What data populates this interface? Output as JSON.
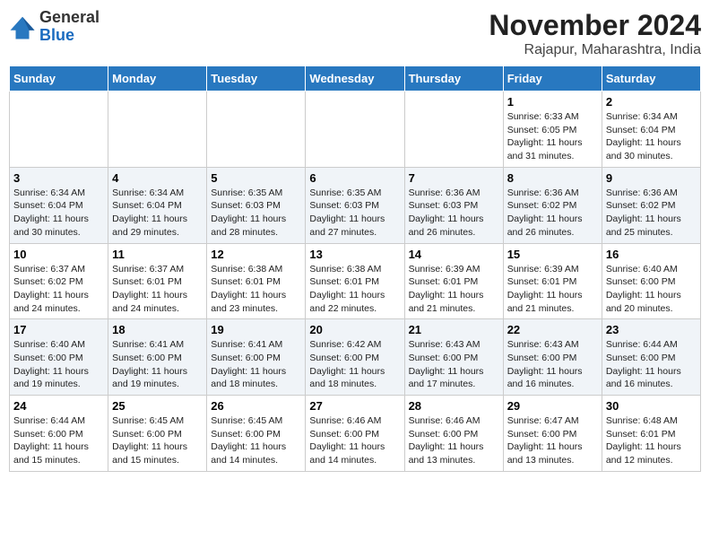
{
  "header": {
    "logo_line1": "General",
    "logo_line2": "Blue",
    "month": "November 2024",
    "location": "Rajapur, Maharashtra, India"
  },
  "days_of_week": [
    "Sunday",
    "Monday",
    "Tuesday",
    "Wednesday",
    "Thursday",
    "Friday",
    "Saturday"
  ],
  "weeks": [
    [
      {
        "day": "",
        "info": ""
      },
      {
        "day": "",
        "info": ""
      },
      {
        "day": "",
        "info": ""
      },
      {
        "day": "",
        "info": ""
      },
      {
        "day": "",
        "info": ""
      },
      {
        "day": "1",
        "info": "Sunrise: 6:33 AM\nSunset: 6:05 PM\nDaylight: 11 hours\nand 31 minutes."
      },
      {
        "day": "2",
        "info": "Sunrise: 6:34 AM\nSunset: 6:04 PM\nDaylight: 11 hours\nand 30 minutes."
      }
    ],
    [
      {
        "day": "3",
        "info": "Sunrise: 6:34 AM\nSunset: 6:04 PM\nDaylight: 11 hours\nand 30 minutes."
      },
      {
        "day": "4",
        "info": "Sunrise: 6:34 AM\nSunset: 6:04 PM\nDaylight: 11 hours\nand 29 minutes."
      },
      {
        "day": "5",
        "info": "Sunrise: 6:35 AM\nSunset: 6:03 PM\nDaylight: 11 hours\nand 28 minutes."
      },
      {
        "day": "6",
        "info": "Sunrise: 6:35 AM\nSunset: 6:03 PM\nDaylight: 11 hours\nand 27 minutes."
      },
      {
        "day": "7",
        "info": "Sunrise: 6:36 AM\nSunset: 6:03 PM\nDaylight: 11 hours\nand 26 minutes."
      },
      {
        "day": "8",
        "info": "Sunrise: 6:36 AM\nSunset: 6:02 PM\nDaylight: 11 hours\nand 26 minutes."
      },
      {
        "day": "9",
        "info": "Sunrise: 6:36 AM\nSunset: 6:02 PM\nDaylight: 11 hours\nand 25 minutes."
      }
    ],
    [
      {
        "day": "10",
        "info": "Sunrise: 6:37 AM\nSunset: 6:02 PM\nDaylight: 11 hours\nand 24 minutes."
      },
      {
        "day": "11",
        "info": "Sunrise: 6:37 AM\nSunset: 6:01 PM\nDaylight: 11 hours\nand 24 minutes."
      },
      {
        "day": "12",
        "info": "Sunrise: 6:38 AM\nSunset: 6:01 PM\nDaylight: 11 hours\nand 23 minutes."
      },
      {
        "day": "13",
        "info": "Sunrise: 6:38 AM\nSunset: 6:01 PM\nDaylight: 11 hours\nand 22 minutes."
      },
      {
        "day": "14",
        "info": "Sunrise: 6:39 AM\nSunset: 6:01 PM\nDaylight: 11 hours\nand 21 minutes."
      },
      {
        "day": "15",
        "info": "Sunrise: 6:39 AM\nSunset: 6:01 PM\nDaylight: 11 hours\nand 21 minutes."
      },
      {
        "day": "16",
        "info": "Sunrise: 6:40 AM\nSunset: 6:00 PM\nDaylight: 11 hours\nand 20 minutes."
      }
    ],
    [
      {
        "day": "17",
        "info": "Sunrise: 6:40 AM\nSunset: 6:00 PM\nDaylight: 11 hours\nand 19 minutes."
      },
      {
        "day": "18",
        "info": "Sunrise: 6:41 AM\nSunset: 6:00 PM\nDaylight: 11 hours\nand 19 minutes."
      },
      {
        "day": "19",
        "info": "Sunrise: 6:41 AM\nSunset: 6:00 PM\nDaylight: 11 hours\nand 18 minutes."
      },
      {
        "day": "20",
        "info": "Sunrise: 6:42 AM\nSunset: 6:00 PM\nDaylight: 11 hours\nand 18 minutes."
      },
      {
        "day": "21",
        "info": "Sunrise: 6:43 AM\nSunset: 6:00 PM\nDaylight: 11 hours\nand 17 minutes."
      },
      {
        "day": "22",
        "info": "Sunrise: 6:43 AM\nSunset: 6:00 PM\nDaylight: 11 hours\nand 16 minutes."
      },
      {
        "day": "23",
        "info": "Sunrise: 6:44 AM\nSunset: 6:00 PM\nDaylight: 11 hours\nand 16 minutes."
      }
    ],
    [
      {
        "day": "24",
        "info": "Sunrise: 6:44 AM\nSunset: 6:00 PM\nDaylight: 11 hours\nand 15 minutes."
      },
      {
        "day": "25",
        "info": "Sunrise: 6:45 AM\nSunset: 6:00 PM\nDaylight: 11 hours\nand 15 minutes."
      },
      {
        "day": "26",
        "info": "Sunrise: 6:45 AM\nSunset: 6:00 PM\nDaylight: 11 hours\nand 14 minutes."
      },
      {
        "day": "27",
        "info": "Sunrise: 6:46 AM\nSunset: 6:00 PM\nDaylight: 11 hours\nand 14 minutes."
      },
      {
        "day": "28",
        "info": "Sunrise: 6:46 AM\nSunset: 6:00 PM\nDaylight: 11 hours\nand 13 minutes."
      },
      {
        "day": "29",
        "info": "Sunrise: 6:47 AM\nSunset: 6:00 PM\nDaylight: 11 hours\nand 13 minutes."
      },
      {
        "day": "30",
        "info": "Sunrise: 6:48 AM\nSunset: 6:01 PM\nDaylight: 11 hours\nand 12 minutes."
      }
    ]
  ]
}
